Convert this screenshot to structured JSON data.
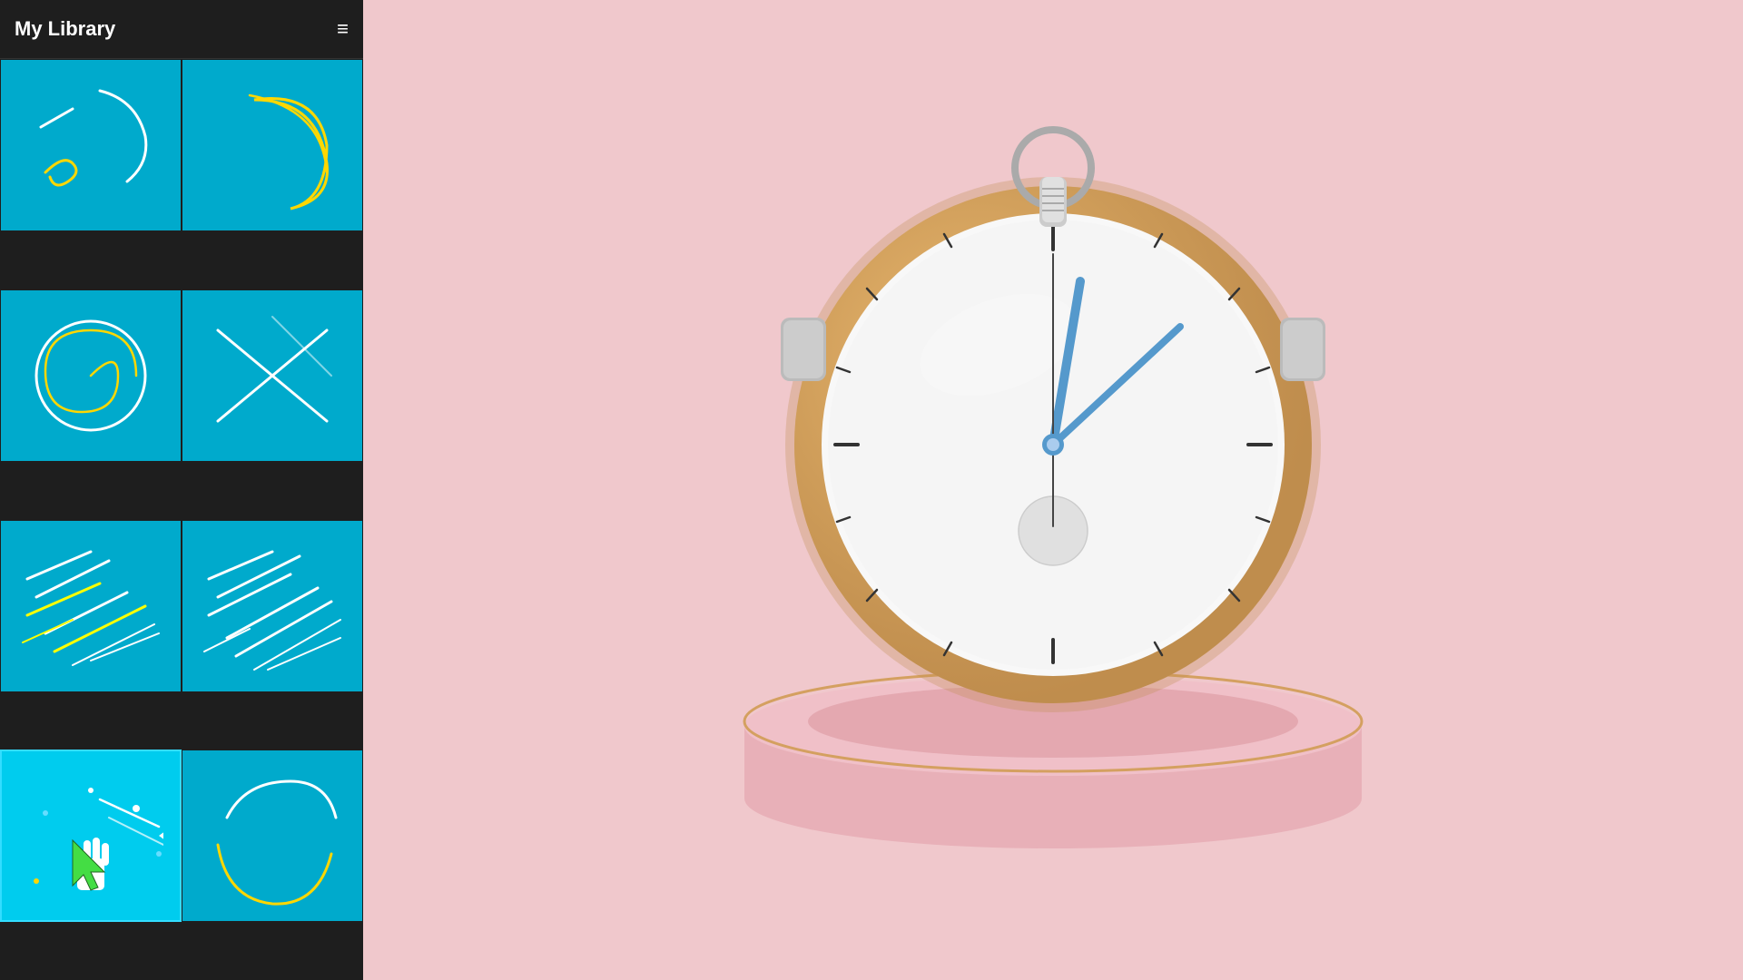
{
  "sidebar": {
    "title": "My Library",
    "menu_icon": "≡",
    "items": [
      {
        "id": "item-1",
        "label": "swirl-lines",
        "selected": false
      },
      {
        "id": "item-2",
        "label": "crescent",
        "selected": false
      },
      {
        "id": "item-3",
        "label": "spiral-circle",
        "selected": false
      },
      {
        "id": "item-4",
        "label": "cross-lines",
        "selected": false
      },
      {
        "id": "item-5",
        "label": "diagonal-lines-color",
        "selected": false
      },
      {
        "id": "item-6",
        "label": "diagonal-lines-white",
        "selected": false
      },
      {
        "id": "item-7",
        "label": "cursor-lines",
        "selected": true
      },
      {
        "id": "item-8",
        "label": "partial-circle",
        "selected": false
      }
    ]
  },
  "main": {
    "content": "stopwatch"
  },
  "colors": {
    "sidebar_bg": "#1e1e1e",
    "tile_bg": "#00AACC",
    "tile_selected": "#00CCEE",
    "main_bg": "#f0c8cc"
  }
}
